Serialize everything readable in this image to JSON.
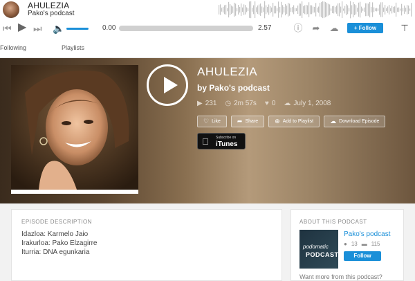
{
  "mini_player": {
    "title": "AHULEZIA",
    "subtitle": "Pako's podcast",
    "current_time": "0.00",
    "duration": "2.57",
    "progress": 0,
    "volume": 0.7,
    "follow_label": "+ Follow"
  },
  "tabs": [
    {
      "label": "Following"
    },
    {
      "label": "Playlists"
    }
  ],
  "episode": {
    "title": "AHULEZIA",
    "by": "by Pako's podcast",
    "plays": "231",
    "length": "2m 57s",
    "likes": "0",
    "date": "July 1, 2008"
  },
  "actions": {
    "like": "Like",
    "share": "Share",
    "add_playlist": "Add to Playlist",
    "download": "Download Episode"
  },
  "itunes": {
    "small": "Subscribe on",
    "big": "iTunes"
  },
  "description": {
    "heading": "EPISODE DESCRIPTION",
    "lines": [
      "Idazloa: Karmelo Jaio",
      "Irakurloa: Pako Elzagirre",
      "Iturria: DNA egunkaria"
    ]
  },
  "about": {
    "heading": "ABOUT THIS PODCAST",
    "logo_text_a": "podomatic",
    "logo_text_b": "PODCAST",
    "name": "Pako's podcast",
    "count_a": "13",
    "count_b": "115",
    "follow_label": "Follow",
    "want_more": "Want more from this podcast?"
  },
  "colors": {
    "accent": "#1a8fd8"
  }
}
